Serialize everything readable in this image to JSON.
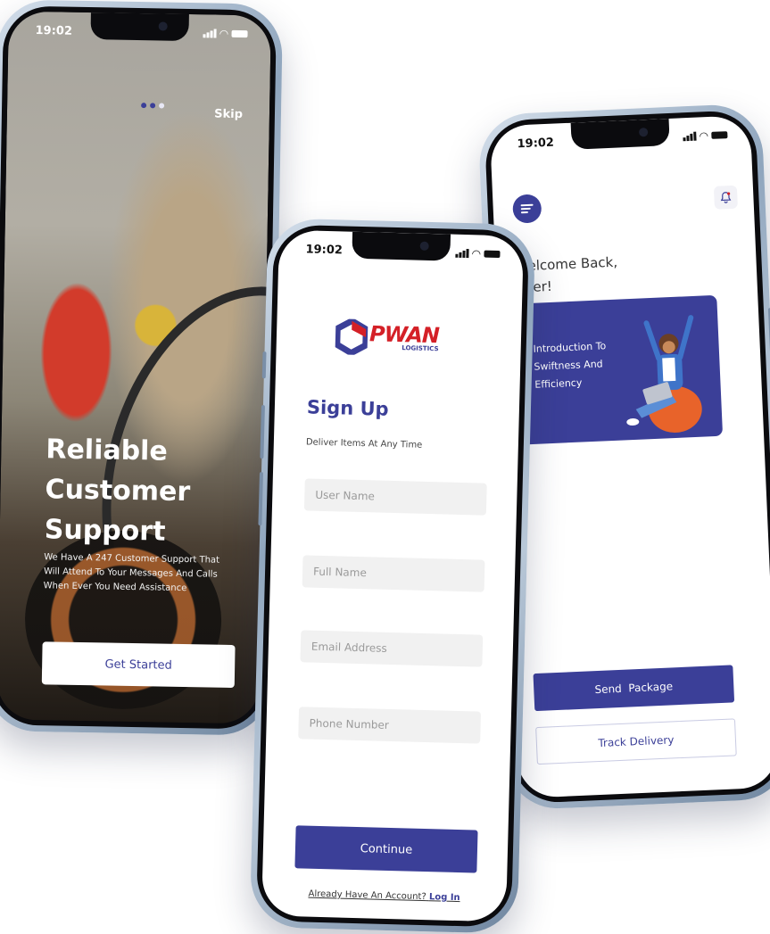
{
  "onboarding": {
    "time": "19:02",
    "skip_label": "Skip",
    "title": "Reliable Customer Support",
    "description": "We Have A 247 Customer Support That Will Attend To Your Messages And Calls When Ever You Need Assistance",
    "cta_label": "Get Started",
    "page_indicator": {
      "total": 3,
      "active": 1
    }
  },
  "signup": {
    "time": "19:02",
    "logo": {
      "brand": "PWAN",
      "sub": "LOGISTICS"
    },
    "title": "Sign Up",
    "subtitle": "Deliver Items At Any Time",
    "fields": {
      "user_name": "User Name",
      "full_name": "Full Name",
      "email": "Email Address",
      "phone": "Phone Number"
    },
    "continue_label": "Continue",
    "footer_text": "Already Have An Account?",
    "login_label": "Log In"
  },
  "home": {
    "time": "19:02",
    "welcome": "Welcome Back, User!",
    "promo_text": "Introduction To Swiftness And Efficiency",
    "send_label": "Send  Package",
    "track_label": "Track Delivery"
  },
  "colors": {
    "brand": "#3b3f98",
    "logo_red": "#d42027",
    "field_bg": "#f1f1f1"
  },
  "icons": [
    "menu-icon",
    "bell-icon",
    "signal-icon",
    "wifi-icon",
    "battery-icon"
  ]
}
